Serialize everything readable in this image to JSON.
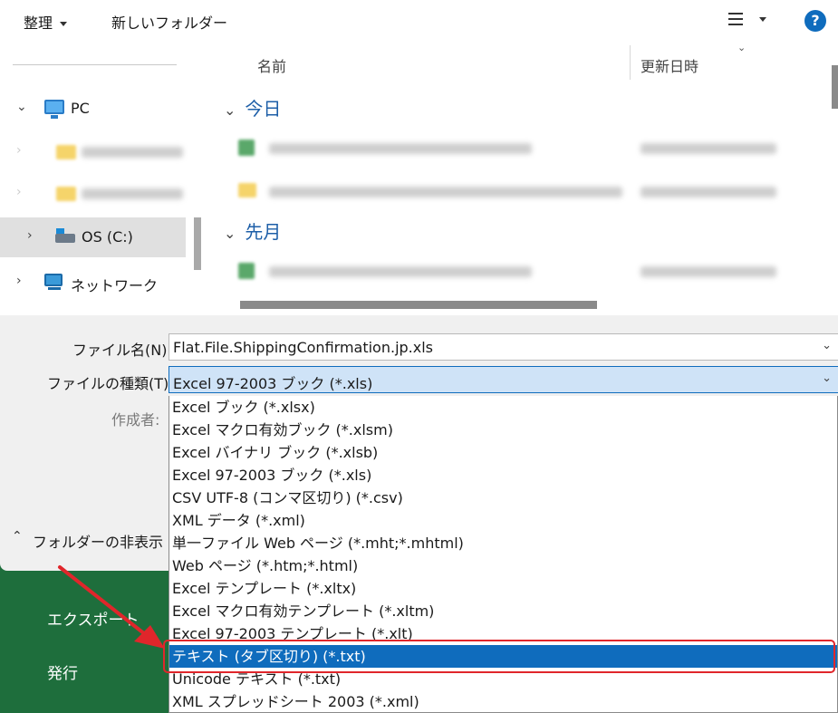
{
  "toolbar": {
    "organize_label": "整理",
    "new_folder_label": "新しいフォルダー",
    "view_icon": "list-view-icon",
    "help_label": "?"
  },
  "nav": {
    "items": [
      {
        "label": "PC",
        "icon": "computer-icon",
        "expanded": true
      },
      {
        "label": "",
        "icon": "folder-icon",
        "blurred": true
      },
      {
        "label": "",
        "icon": "folder-icon",
        "blurred": true
      },
      {
        "label": "OS (C:)",
        "icon": "drive-icon",
        "selected": true
      },
      {
        "label": "ネットワーク",
        "icon": "network-icon"
      }
    ]
  },
  "list": {
    "col_name": "名前",
    "col_date": "更新日時",
    "groups": [
      {
        "label": "今日"
      },
      {
        "label": "先月"
      }
    ]
  },
  "form": {
    "filename_label": "ファイル名(N):",
    "filename_value": "Flat.File.ShippingConfirmation.jp.xls",
    "filetype_label": "ファイルの種類(T):",
    "filetype_value": "Excel 97-2003 ブック (*.xls)",
    "author_label": "作成者:"
  },
  "folder_toggle_label": "フォルダーの非表示",
  "backstage": {
    "export_label": "エクスポート",
    "publish_label": "発行"
  },
  "filetype_options": [
    "Excel ブック (*.xlsx)",
    "Excel マクロ有効ブック (*.xlsm)",
    "Excel バイナリ ブック (*.xlsb)",
    "Excel 97-2003 ブック (*.xls)",
    "CSV UTF-8 (コンマ区切り) (*.csv)",
    "XML データ (*.xml)",
    "単一ファイル Web ページ (*.mht;*.mhtml)",
    "Web ページ (*.htm;*.html)",
    "Excel テンプレート (*.xltx)",
    "Excel マクロ有効テンプレート (*.xltm)",
    "Excel 97-2003 テンプレート (*.xlt)",
    "テキスト (タブ区切り) (*.txt)",
    "Unicode テキスト (*.txt)",
    "XML スプレッドシート 2003 (*.xml)"
  ],
  "selected_option_index": 11,
  "colors": {
    "accent": "#0f6cbd",
    "highlight_border": "#e0262b",
    "backstage_green": "#1e6e3c"
  }
}
